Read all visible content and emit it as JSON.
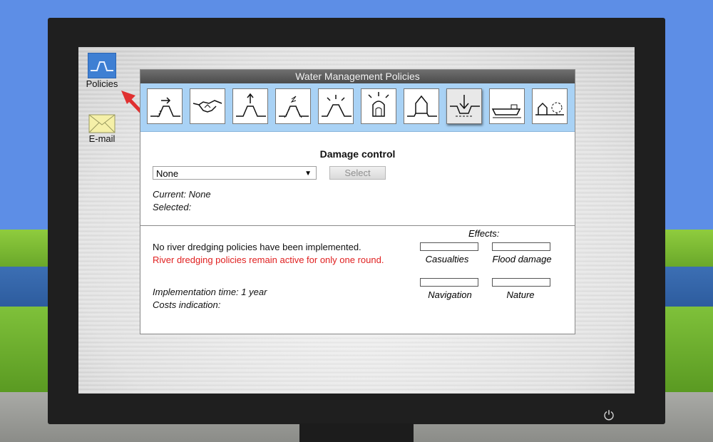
{
  "desktop": {
    "icons": [
      {
        "label": "Policies",
        "icon": "policies-wave-icon"
      },
      {
        "label": "E-mail",
        "icon": "envelope-icon"
      }
    ]
  },
  "window": {
    "title": "Water Management Policies",
    "toolbar": [
      {
        "icon": "dike-relocation-icon"
      },
      {
        "icon": "agreement-handshake-icon"
      },
      {
        "icon": "dike-raising-icon"
      },
      {
        "icon": "dike-strengthening-icon"
      },
      {
        "icon": "floodplain-lowering-icon"
      },
      {
        "icon": "flood-alarm-icon"
      },
      {
        "icon": "house-on-mound-icon"
      },
      {
        "icon": "river-dredging-icon",
        "selected": true
      },
      {
        "icon": "shipping-icon"
      },
      {
        "icon": "nature-houses-icon"
      }
    ],
    "section_title": "Damage control",
    "dropdown_value": "None",
    "select_button": "Select",
    "current": "Current: None",
    "selected": "Selected:",
    "description": "No river dredging policies have been implemented.",
    "warning": "River dredging policies remain active for only one round.",
    "implementation_time": "Implementation time: 1 year",
    "costs": "Costs indication:",
    "effects": {
      "title": "Effects:",
      "casualties": "Casualties",
      "flood_damage": "Flood damage",
      "navigation": "Navigation",
      "nature": "Nature"
    }
  },
  "colors": {
    "sky": "#5d8ee6",
    "toolbar": "#a9d2f5",
    "warning": "#e02020"
  }
}
